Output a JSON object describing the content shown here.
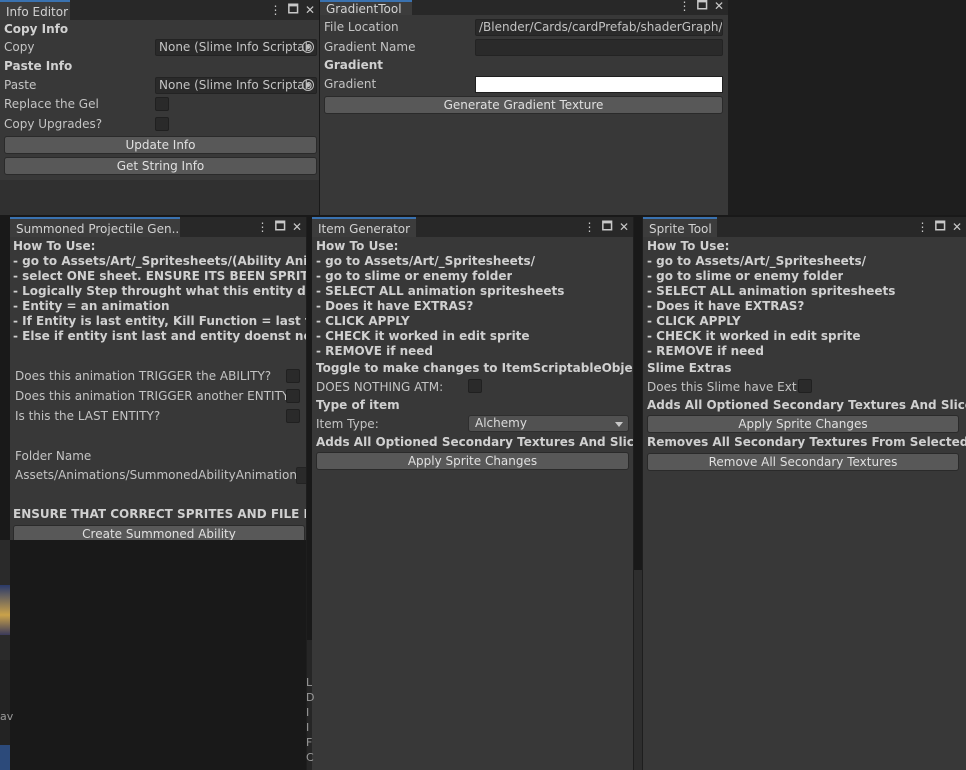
{
  "info_editor": {
    "title": "Info Editor",
    "copy_info_header": "Copy Info",
    "copy_label": "Copy",
    "copy_value": "None (Slime Info Scriptab",
    "paste_info_header": "Paste Info",
    "paste_label": "Paste",
    "paste_value": "None (Slime Info Scriptab",
    "replace_gel_label": "Replace the Gel",
    "copy_upgrades_label": "Copy Upgrades?",
    "update_info_button": "Update Info",
    "get_string_info_button": "Get String Info"
  },
  "gradient_tool": {
    "title": "GradientTool",
    "file_location_label": "File Location",
    "file_location_value": "/Blender/Cards/cardPrefab/shaderGraph/Gr",
    "gradient_name_label": "Gradient Name",
    "gradient_name_value": "",
    "gradient_header": "Gradient",
    "gradient_label": "Gradient",
    "gradient_color": "#ffffff",
    "generate_button": "Generate Gradient Texture"
  },
  "summoned_projectile": {
    "title": "Summoned Projectile Gen...",
    "how_to_use": "How To Use:",
    "steps": [
      "- go to Assets/Art/_Spritesheets/(Ability Animat",
      "- select ONE sheet. ENSURE ITS BEEN SPRITE TOO",
      "- Logically Step throught what this entity does",
      "- Entity = an animation",
      "- If Entity is last entity, Kill Function = last frame",
      "- Else if entity isnt last and entity doenst need to p"
    ],
    "trigger_ability_label": "Does this animation TRIGGER the ABILITY?",
    "trigger_entity_label": "Does this animation TRIGGER another ENTITY?",
    "last_entity_label": "Is this the LAST ENTITY?",
    "folder_name_label": "Folder Name",
    "folder_name_value": "Assets/Animations/SummonedAbilityAnimations/",
    "ensure_text": "ENSURE THAT CORRECT SPRITES AND FILE PATH",
    "create_button": "Create Summoned Ability"
  },
  "item_generator": {
    "title": "Item Generator",
    "how_to_use": "How To Use:",
    "steps": [
      "- go to Assets/Art/_Spritesheets/",
      "- go to slime or enemy folder",
      "- SELECT ALL animation spritesheets",
      "- Does it have EXTRAS?",
      "- CLICK APPLY",
      "- CHECK it worked in edit sprite",
      "- REMOVE if need"
    ],
    "toggle_text": "Toggle to make changes to ItemScriptableObjectFact",
    "does_nothing_label": "DOES NOTHING ATM:",
    "type_header": "Type of item",
    "item_type_label": "Item Type:",
    "item_type_value": "Alchemy",
    "adds_text": "Adds All Optioned Secondary Textures And Slices To",
    "apply_button": "Apply Sprite Changes"
  },
  "sprite_tool": {
    "title": "Sprite Tool",
    "how_to_use": "How To Use:",
    "steps": [
      "- go to Assets/Art/_Spritesheets/",
      "- go to slime or enemy folder",
      "- SELECT ALL animation spritesheets",
      "- Does it have EXTRAS?",
      "- CLICK APPLY",
      "- CHECK it worked in edit sprite",
      "- REMOVE if need"
    ],
    "extras_header": "Slime Extras",
    "extras_label": "Does this Slime have Extra",
    "adds_text": "Adds All Optioned Secondary Textures And Slices To",
    "apply_button": "Apply Sprite Changes",
    "removes_text": "Removes All Secondary Textures From Selected Sprit",
    "remove_button": "Remove All Secondary Textures"
  },
  "window_controls": {
    "menu": "⋮",
    "maximize": "🗖",
    "close": "✕"
  },
  "background": {
    "fragments": [
      "L",
      "D",
      "I",
      "I",
      "F",
      "C"
    ],
    "left_fragment": "av"
  },
  "colors": {
    "window_bg": "#383838",
    "tab_accent": "#3a72b0",
    "button_bg": "#585858"
  }
}
